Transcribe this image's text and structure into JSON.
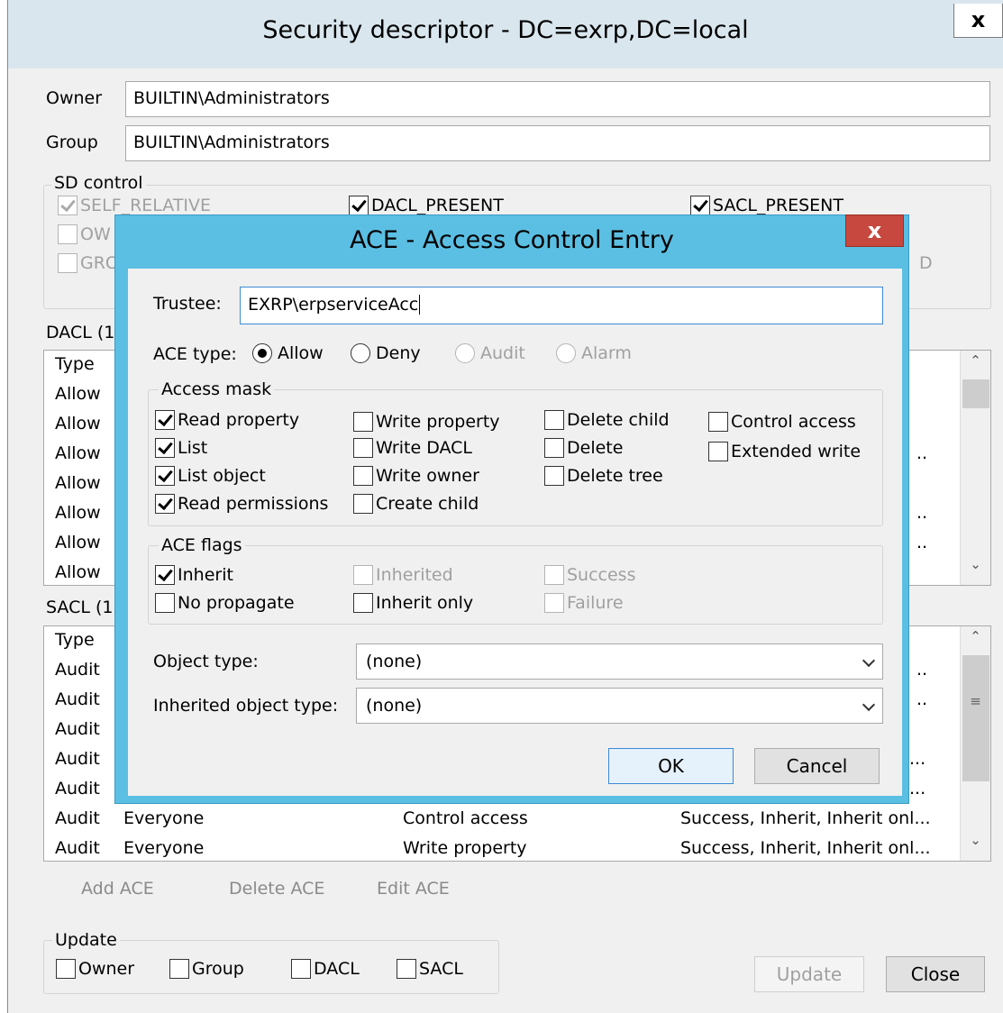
{
  "outer": {
    "title": "Security descriptor - DC=exrp,DC=local",
    "close_glyph": "x",
    "owner_label": "Owner",
    "owner_value": "BUILTIN\\Administrators",
    "group_label": "Group",
    "group_value": "BUILTIN\\Administrators",
    "sd_control": {
      "title": "SD control",
      "items": [
        {
          "label": "SELF_RELATIVE",
          "checked": true,
          "disabled": true
        },
        {
          "label": "DACL_PRESENT",
          "checked": true,
          "disabled": false
        },
        {
          "label": "SACL_PRESENT",
          "checked": true,
          "disabled": false
        },
        {
          "label": "OW",
          "checked": false,
          "disabled": true
        },
        {
          "label": "GRO",
          "checked": false,
          "disabled": true
        },
        {
          "label": "D",
          "checked": false,
          "disabled": true
        }
      ]
    },
    "dacl": {
      "label": "DACL (1",
      "column_type": "Type",
      "rows": [
        {
          "type": "Allow",
          "extra": ""
        },
        {
          "type": "Allow",
          "extra": ""
        },
        {
          "type": "Allow",
          "extra": ".."
        },
        {
          "type": "Allow",
          "extra": ""
        },
        {
          "type": "Allow",
          "extra": ".."
        },
        {
          "type": "Allow",
          "extra": ".."
        },
        {
          "type": "Allow",
          "extra": ""
        }
      ]
    },
    "sacl": {
      "label": "SACL (1",
      "column_type": "Type",
      "rows": [
        {
          "type": "Audit",
          "trustee": "",
          "mask": "",
          "flags": ".."
        },
        {
          "type": "Audit",
          "trustee": "",
          "mask": "",
          "flags": ".."
        },
        {
          "type": "Audit",
          "trustee": "",
          "mask": "",
          "flags": ""
        },
        {
          "type": "Audit",
          "trustee": "",
          "mask": "",
          "flags": "..."
        },
        {
          "type": "Audit",
          "trustee": "",
          "mask": "",
          "flags": "..."
        },
        {
          "type": "Audit",
          "trustee": "Everyone",
          "mask": "Control access",
          "flags": "Success, Inherit, Inherit onl..."
        },
        {
          "type": "Audit",
          "trustee": "Everyone",
          "mask": "Write property",
          "flags": "Success, Inherit, Inherit onl..."
        }
      ]
    },
    "actions": {
      "add": "Add ACE",
      "delete": "Delete ACE",
      "edit": "Edit ACE"
    },
    "update_group": {
      "title": "Update",
      "items": [
        "Owner",
        "Group",
        "DACL",
        "SACL"
      ]
    },
    "update_button": "Update",
    "close_button": "Close"
  },
  "ace": {
    "title": "ACE - Access Control Entry",
    "close_glyph": "x",
    "trustee_label": "Trustee:",
    "trustee_value": "EXRP\\erpserviceAcc",
    "ace_type_label": "ACE type:",
    "ace_types": [
      {
        "label": "Allow",
        "selected": true,
        "disabled": false
      },
      {
        "label": "Deny",
        "selected": false,
        "disabled": false
      },
      {
        "label": "Audit",
        "selected": false,
        "disabled": true
      },
      {
        "label": "Alarm",
        "selected": false,
        "disabled": true
      }
    ],
    "access_mask": {
      "title": "Access mask",
      "items": [
        {
          "label": "Read property",
          "checked": true
        },
        {
          "label": "List",
          "checked": true
        },
        {
          "label": "List object",
          "checked": true
        },
        {
          "label": "Read permissions",
          "checked": true
        },
        {
          "label": "Write property",
          "checked": false
        },
        {
          "label": "Write DACL",
          "checked": false
        },
        {
          "label": "Write owner",
          "checked": false
        },
        {
          "label": "Create child",
          "checked": false
        },
        {
          "label": "Delete child",
          "checked": false
        },
        {
          "label": "Delete",
          "checked": false
        },
        {
          "label": "Delete tree",
          "checked": false
        },
        {
          "label": "Control access",
          "checked": false
        },
        {
          "label": "Extended write",
          "checked": false
        }
      ]
    },
    "ace_flags": {
      "title": "ACE flags",
      "items": [
        {
          "label": "Inherit",
          "checked": true,
          "disabled": false
        },
        {
          "label": "No propagate",
          "checked": false,
          "disabled": false
        },
        {
          "label": "Inherited",
          "checked": false,
          "disabled": true
        },
        {
          "label": "Inherit only",
          "checked": false,
          "disabled": false
        },
        {
          "label": "Success",
          "checked": false,
          "disabled": true
        },
        {
          "label": "Failure",
          "checked": false,
          "disabled": true
        }
      ]
    },
    "object_type_label": "Object type:",
    "object_type_value": "(none)",
    "inherited_object_type_label": "Inherited object type:",
    "inherited_object_type_value": "(none)",
    "ok_button": "OK",
    "cancel_button": "Cancel"
  }
}
